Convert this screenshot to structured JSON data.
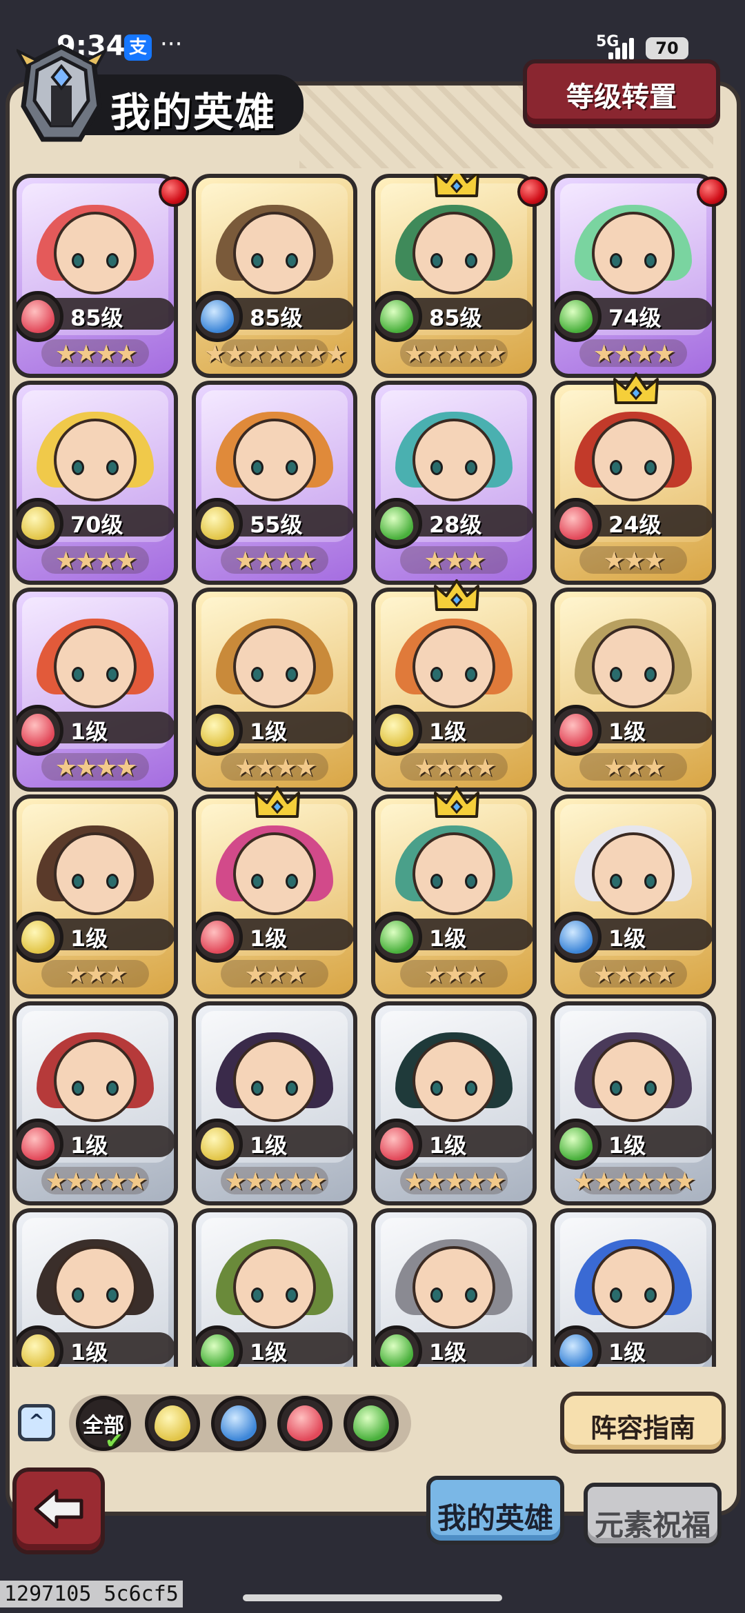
{
  "status_bar": {
    "time": "9:34",
    "pay_icon_label": "支",
    "more": "···",
    "network": "5G",
    "battery": "70"
  },
  "header": {
    "title": "我的英雄",
    "level_transfer_button": "等级转置"
  },
  "heroes": [
    {
      "level": "85级",
      "stars": "★★★★",
      "element": "fire",
      "rarity": "purple",
      "crown": false,
      "red_dot": true
    },
    {
      "level": "85级",
      "stars": "★★★★★★★",
      "element": "water",
      "rarity": "gold",
      "crown": false,
      "red_dot": false
    },
    {
      "level": "85级",
      "stars": "★★★★★",
      "element": "wind",
      "rarity": "gold",
      "crown": true,
      "red_dot": true
    },
    {
      "level": "74级",
      "stars": "★★★★",
      "element": "wind",
      "rarity": "purple",
      "crown": false,
      "red_dot": true
    },
    {
      "level": "70级",
      "stars": "★★★★",
      "element": "earth",
      "rarity": "purple",
      "crown": false,
      "red_dot": false
    },
    {
      "level": "55级",
      "stars": "★★★★",
      "element": "earth",
      "rarity": "purple",
      "crown": false,
      "red_dot": false
    },
    {
      "level": "28级",
      "stars": "★★★",
      "element": "wind",
      "rarity": "purple",
      "crown": false,
      "red_dot": false
    },
    {
      "level": "24级",
      "stars": "★★★",
      "element": "fire",
      "rarity": "gold",
      "crown": true,
      "red_dot": false
    },
    {
      "level": "1级",
      "stars": "★★★★",
      "element": "fire",
      "rarity": "purple",
      "crown": false,
      "red_dot": false
    },
    {
      "level": "1级",
      "stars": "★★★★",
      "element": "earth",
      "rarity": "gold",
      "crown": false,
      "red_dot": false
    },
    {
      "level": "1级",
      "stars": "★★★★",
      "element": "earth",
      "rarity": "gold",
      "crown": true,
      "red_dot": false
    },
    {
      "level": "1级",
      "stars": "★★★",
      "element": "fire",
      "rarity": "gold",
      "crown": false,
      "red_dot": false
    },
    {
      "level": "1级",
      "stars": "★★★",
      "element": "earth",
      "rarity": "gold",
      "crown": false,
      "red_dot": false
    },
    {
      "level": "1级",
      "stars": "★★★",
      "element": "fire",
      "rarity": "gold",
      "crown": true,
      "red_dot": false
    },
    {
      "level": "1级",
      "stars": "★★★",
      "element": "wind",
      "rarity": "gold",
      "crown": true,
      "red_dot": false
    },
    {
      "level": "1级",
      "stars": "★★★★",
      "element": "water",
      "rarity": "gold",
      "crown": false,
      "red_dot": false
    },
    {
      "level": "1级",
      "stars": "★★★★★",
      "element": "fire",
      "rarity": "silver",
      "crown": false,
      "red_dot": false
    },
    {
      "level": "1级",
      "stars": "★★★★★",
      "element": "earth",
      "rarity": "silver",
      "crown": false,
      "red_dot": false
    },
    {
      "level": "1级",
      "stars": "★★★★★",
      "element": "fire",
      "rarity": "silver",
      "crown": false,
      "red_dot": false
    },
    {
      "level": "1级",
      "stars": "★★★★★★",
      "element": "wind",
      "rarity": "silver",
      "crown": false,
      "red_dot": false
    },
    {
      "level": "1级",
      "stars": "",
      "element": "earth",
      "rarity": "silver",
      "crown": false,
      "red_dot": false
    },
    {
      "level": "1级",
      "stars": "",
      "element": "wind",
      "rarity": "silver",
      "crown": false,
      "red_dot": false
    },
    {
      "level": "1级",
      "stars": "",
      "element": "wind",
      "rarity": "silver",
      "crown": false,
      "red_dot": false
    },
    {
      "level": "1级",
      "stars": "",
      "element": "water",
      "rarity": "silver",
      "crown": false,
      "red_dot": false
    }
  ],
  "filters": {
    "all_label": "全部",
    "selected": "all",
    "elements": [
      "earth",
      "water",
      "fire",
      "wind"
    ]
  },
  "guide_button": "阵容指南",
  "tabs": [
    {
      "label": "我的英雄",
      "active": true
    },
    {
      "label": "元素祝福",
      "active": false
    }
  ],
  "colors": {
    "panel": "#e8dcc4",
    "level_button": "#8a2630",
    "back_button": "#9a2b32",
    "active_tab": "#7ab7e6",
    "fire": "#e2495a",
    "water": "#3d86d8",
    "wind": "#49b03c",
    "earth": "#e2c548"
  },
  "icons": {
    "header": "knight-helmet-icon",
    "back": "back-arrow-icon",
    "collapse": "chevron-up-icon"
  },
  "watermark": "1297105 5c6cf5"
}
